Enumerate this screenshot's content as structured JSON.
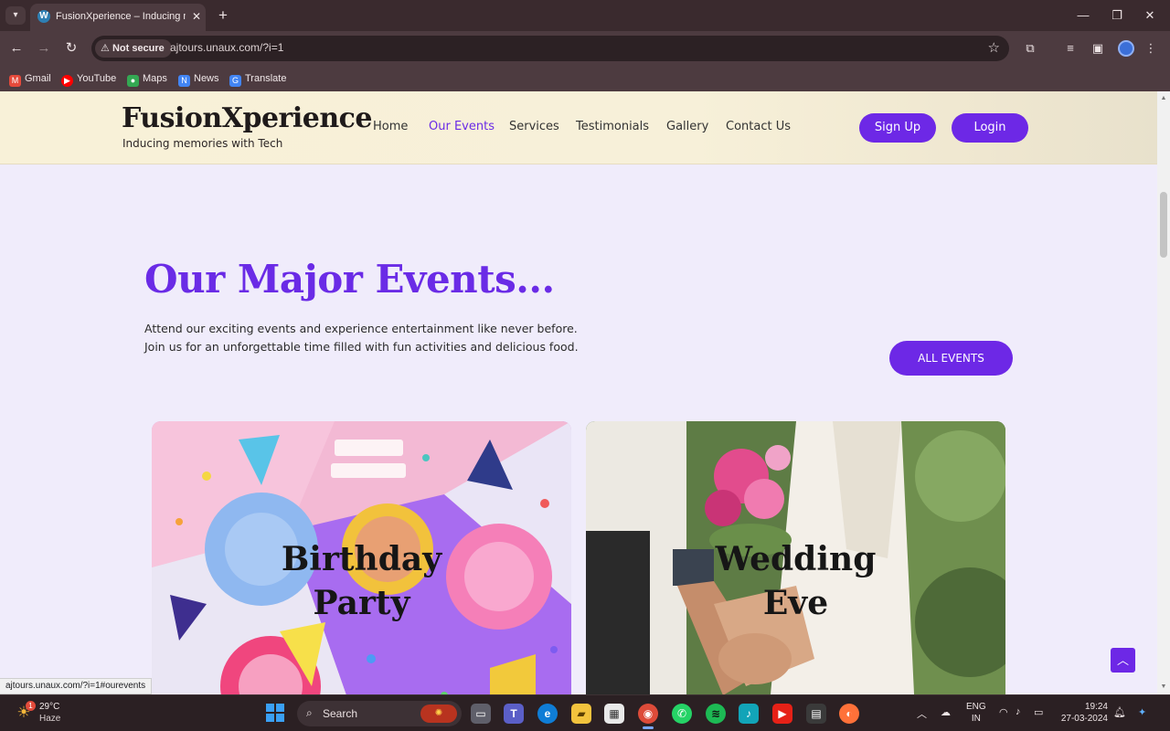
{
  "browser": {
    "tab_title": "FusionXperience – Inducing me",
    "tab_close": "✕",
    "new_tab": "+",
    "window_controls": [
      "—",
      "❐",
      "✕"
    ],
    "not_secure_label": "Not secure",
    "url": "ajtours.unaux.com/?i=1",
    "bookmarks": [
      {
        "label": "Gmail",
        "icon": "gmail-icon",
        "color": "#e64a3b"
      },
      {
        "label": "YouTube",
        "icon": "youtube-icon",
        "color": "#ff0000"
      },
      {
        "label": "Maps",
        "icon": "maps-icon",
        "color": "#34a853"
      },
      {
        "label": "News",
        "icon": "news-icon",
        "color": "#4285f4"
      },
      {
        "label": "Translate",
        "icon": "translate-icon",
        "color": "#4285f4"
      }
    ],
    "status_url": "ajtours.unaux.com/?i=1#ourevents"
  },
  "site": {
    "logo_title": "FusionXperience",
    "logo_subtitle": "Inducing memories with Tech",
    "nav": [
      {
        "label": "Home",
        "active": false
      },
      {
        "label": "Our Events",
        "active": true
      },
      {
        "label": "Services",
        "active": false
      },
      {
        "label": "Testimonials",
        "active": false
      },
      {
        "label": "Gallery",
        "active": false
      },
      {
        "label": "Contact Us",
        "active": false
      }
    ],
    "signup_label": "Sign Up",
    "login_label": "Login",
    "accent_color": "#6d28e6",
    "section_title": "Our Major Events...",
    "section_description": "Attend our exciting events and experience entertainment like never before. Join us for an unforgettable time filled with fun activities and delicious food.",
    "all_events_label": "ALL EVENTS",
    "events": [
      {
        "line1": "Birthday",
        "line2": "Party"
      },
      {
        "line1": "Wedding",
        "line2": "Eve"
      }
    ],
    "back_to_top_icon": "arrow-up-icon"
  },
  "taskbar": {
    "weather_temp": "29°C",
    "weather_condition": "Haze",
    "weather_badge": "1",
    "search_label": "Search",
    "lang_top": "ENG",
    "lang_bottom": "IN",
    "time": "19:24",
    "date": "27-03-2024"
  }
}
